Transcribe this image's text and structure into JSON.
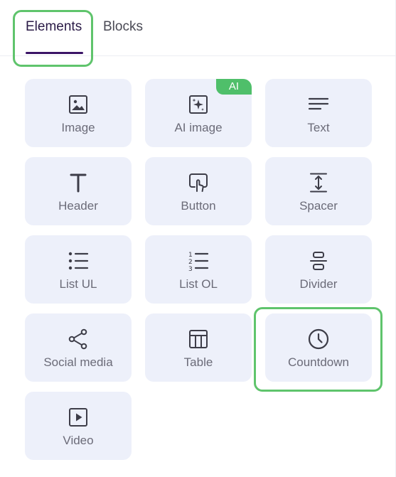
{
  "tabs": [
    {
      "label": "Elements",
      "active": true
    },
    {
      "label": "Blocks",
      "active": false
    }
  ],
  "tiles": [
    {
      "label": "Image",
      "icon": "image-icon"
    },
    {
      "label": "AI image",
      "icon": "ai-image-icon",
      "badge": "AI"
    },
    {
      "label": "Text",
      "icon": "text-lines-icon"
    },
    {
      "label": "Header",
      "icon": "header-t-icon"
    },
    {
      "label": "Button",
      "icon": "button-click-icon"
    },
    {
      "label": "Spacer",
      "icon": "spacer-icon"
    },
    {
      "label": "List UL",
      "icon": "list-ul-icon"
    },
    {
      "label": "List OL",
      "icon": "list-ol-icon"
    },
    {
      "label": "Divider",
      "icon": "divider-icon"
    },
    {
      "label": "Social media",
      "icon": "share-icon"
    },
    {
      "label": "Table",
      "icon": "table-icon"
    },
    {
      "label": "Countdown",
      "icon": "clock-icon"
    },
    {
      "label": "Video",
      "icon": "video-play-icon"
    }
  ],
  "colors": {
    "tile_bg": "#edf0fa",
    "icon_color": "#3d3d48",
    "label_color": "#6b6b78",
    "active_tab_underline": "#3b1466",
    "highlight_outline": "#5fc46c",
    "ai_badge": "#4fbf6a"
  }
}
